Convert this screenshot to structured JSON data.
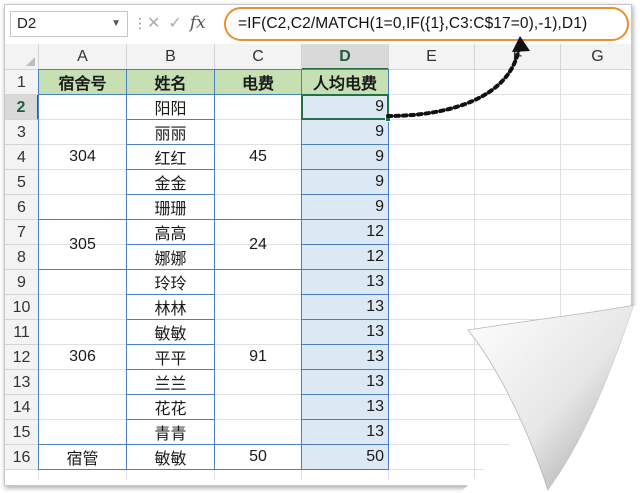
{
  "formula_bar": {
    "name_box": "D2",
    "name_box_dropdown_icon": "chevron-down-icon",
    "more_icon": "vertical-dots-icon",
    "cancel_icon": "close-icon",
    "enter_icon": "check-icon",
    "function_icon": "fx-icon",
    "function_label": "fx",
    "formula": "=IF(C2,C2/MATCH(1=0,IF({1},C3:C$17=0),-1),D1)",
    "highlight_color": "#e98f2c"
  },
  "columns": [
    "A",
    "B",
    "C",
    "D",
    "E",
    "F",
    "G"
  ],
  "rows": [
    "1",
    "2",
    "3",
    "4",
    "5",
    "6",
    "7",
    "8",
    "9",
    "10",
    "11",
    "12",
    "13",
    "14",
    "15",
    "16"
  ],
  "header": {
    "a": "宿舍号",
    "b": "姓名",
    "c": "电费",
    "d": "人均电费"
  },
  "groups": [
    {
      "room": "304",
      "fee": "45"
    },
    {
      "room": "305",
      "fee": "24"
    },
    {
      "room": "306",
      "fee": "91"
    },
    {
      "room": "宿管",
      "fee": "50"
    }
  ],
  "names": [
    "阳阳",
    "丽丽",
    "红红",
    "金金",
    "珊珊",
    "高高",
    "娜娜",
    "玲玲",
    "林林",
    "敏敏",
    "平平",
    "兰兰",
    "花花",
    "青青",
    "敏敏"
  ],
  "per_person": [
    "9",
    "9",
    "9",
    "9",
    "9",
    "12",
    "12",
    "13",
    "13",
    "13",
    "13",
    "13",
    "13",
    "13",
    "50"
  ],
  "colors": {
    "header_fill": "#c6e0b4",
    "column_d_fill": "#dde8f5",
    "border": "#4a7fc1",
    "selection": "#217346"
  }
}
